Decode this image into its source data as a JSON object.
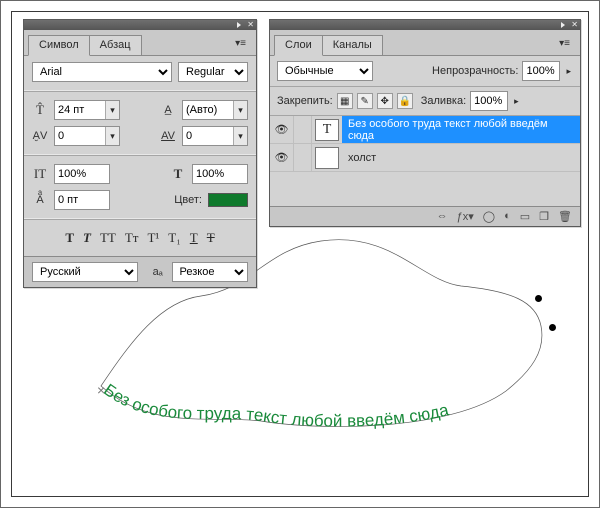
{
  "character_panel": {
    "tabs": {
      "symbol": "Символ",
      "paragraph": "Абзац"
    },
    "font_family": "Arial",
    "font_style": "Regular",
    "font_size": "24 пт",
    "leading": "(Авто)",
    "kerning": "0",
    "tracking": "0",
    "v_scale": "100%",
    "h_scale": "100%",
    "baseline": "0 пт",
    "color_label": "Цвет:",
    "color_hex": "#0f7a2c",
    "language": "Русский",
    "aa_label": "aₐ",
    "aa_mode": "Резкое"
  },
  "layers_panel": {
    "tabs": {
      "layers": "Слои",
      "channels": "Каналы"
    },
    "blend_mode": "Обычные",
    "opacity_label": "Непрозрачность:",
    "opacity": "100%",
    "lock_label": "Закрепить:",
    "fill_label": "Заливка:",
    "fill": "100%",
    "items": [
      {
        "thumb": "T",
        "name": "Без особого труда текст любой введём сюда",
        "selected": true
      },
      {
        "thumb": "",
        "name": "холст",
        "selected": false
      }
    ]
  },
  "canvas": {
    "path_text": "Без особого труда  текст любой введём сюда"
  }
}
